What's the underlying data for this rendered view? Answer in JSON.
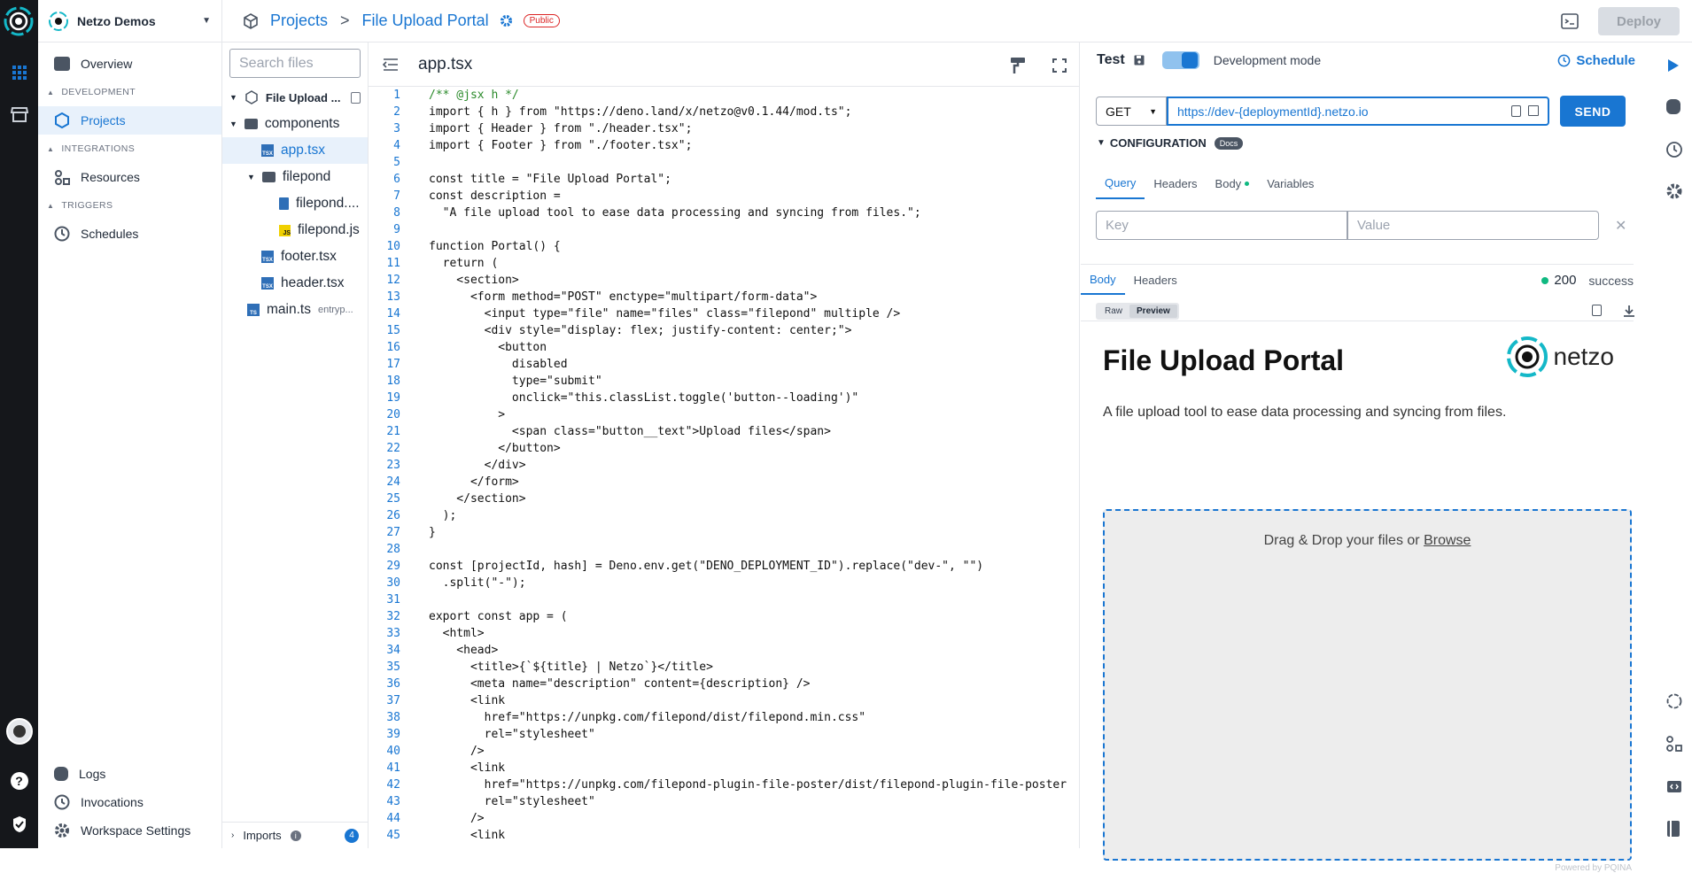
{
  "workspace": {
    "name": "Netzo Demos"
  },
  "nav": {
    "overview": "Overview",
    "development": "DEVELOPMENT",
    "projects": "Projects",
    "integrations": "INTEGRATIONS",
    "resources": "Resources",
    "triggers": "TRIGGERS",
    "schedules": "Schedules",
    "logs": "Logs",
    "invocations": "Invocations",
    "workspace_settings": "Workspace Settings"
  },
  "breadcrumb": {
    "root": "Projects",
    "sep": ">",
    "project": "File Upload Portal",
    "visibility": "Public"
  },
  "toolbar": {
    "deploy": "Deploy"
  },
  "files": {
    "search_placeholder": "Search files",
    "project": "File Upload ...",
    "items": [
      {
        "label": "components",
        "type": "folder"
      },
      {
        "label": "app.tsx",
        "type": "tsx"
      },
      {
        "label": "filepond",
        "type": "folder"
      },
      {
        "label": "filepond....",
        "type": "css"
      },
      {
        "label": "filepond.js",
        "type": "js"
      },
      {
        "label": "footer.tsx",
        "type": "tsx"
      },
      {
        "label": "header.tsx",
        "type": "tsx"
      },
      {
        "label": "main.ts",
        "type": "ts",
        "note": "entryp..."
      }
    ],
    "imports": "Imports",
    "imports_count": "4"
  },
  "editor": {
    "filename": "app.tsx",
    "lines": [
      "/** @jsx h */",
      "import { h } from \"https://deno.land/x/netzo@v0.1.44/mod.ts\";",
      "import { Header } from \"./header.tsx\";",
      "import { Footer } from \"./footer.tsx\";",
      "",
      "const title = \"File Upload Portal\";",
      "const description =",
      "  \"A file upload tool to ease data processing and syncing from files.\";",
      "",
      "function Portal() {",
      "  return (",
      "    <section>",
      "      <form method=\"POST\" enctype=\"multipart/form-data\">",
      "        <input type=\"file\" name=\"files\" class=\"filepond\" multiple />",
      "        <div style=\"display: flex; justify-content: center;\">",
      "          <button",
      "            disabled",
      "            type=\"submit\"",
      "            onclick=\"this.classList.toggle('button--loading')\"",
      "          >",
      "            <span class=\"button__text\">Upload files</span>",
      "          </button>",
      "        </div>",
      "      </form>",
      "    </section>",
      "  );",
      "}",
      "",
      "const [projectId, hash] = Deno.env.get(\"DENO_DEPLOYMENT_ID\").replace(\"dev-\", \"\")",
      "  .split(\"-\");",
      "",
      "export const app = (",
      "  <html>",
      "    <head>",
      "      <title>{`${title} | Netzo`}</title>",
      "      <meta name=\"description\" content={description} />",
      "      <link",
      "        href=\"https://unpkg.com/filepond/dist/filepond.min.css\"",
      "        rel=\"stylesheet\"",
      "      />",
      "      <link",
      "        href=\"https://unpkg.com/filepond-plugin-file-poster/dist/filepond-plugin-file-poster",
      "        rel=\"stylesheet\"",
      "      />",
      "      <link"
    ]
  },
  "test": {
    "title": "Test",
    "mode": "Development mode",
    "schedule": "Schedule",
    "method": "GET",
    "url": "https://dev-{deploymentId}.netzo.io",
    "send": "SEND",
    "configuration": "CONFIGURATION",
    "docs": "Docs",
    "tabs": [
      "Query",
      "Headers",
      "Body",
      "Variables"
    ],
    "key_placeholder": "Key",
    "value_placeholder": "Value",
    "resp_tabs": [
      "Body",
      "Headers"
    ],
    "status_code": "200",
    "status_text": "success",
    "view_raw": "Raw",
    "view_preview": "Preview"
  },
  "preview": {
    "title": "File Upload Portal",
    "brand": "netzo",
    "description": "A file upload tool to ease data processing and syncing from files.",
    "drop_text": "Drag & Drop your files or ",
    "browse": "Browse",
    "powered": "Powered by PQINA"
  }
}
